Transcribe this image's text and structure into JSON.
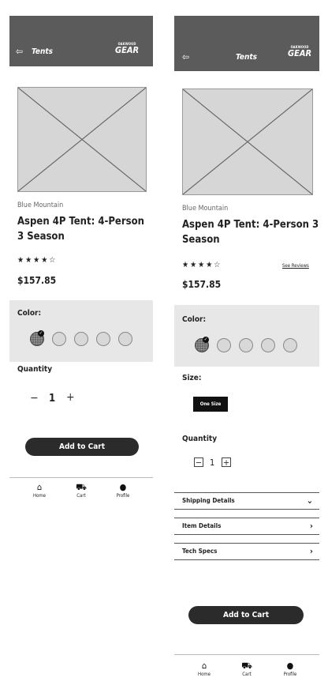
{
  "left": {
    "header": {
      "back_icon": "back-arrow",
      "title": "Tents"
    },
    "logo": {
      "small": "OAKWOOD",
      "big": "GEAR"
    },
    "product": {
      "brand": "Blue Mountain",
      "name": "Aspen 4P Tent: 4-Person 3 Season",
      "rating_stars": "★★★★☆",
      "price": "$157.85"
    },
    "color": {
      "label": "Color:",
      "selected_mark": "✓"
    },
    "quantity": {
      "label": "Quantity",
      "minus": "−",
      "value": "1",
      "plus": "+"
    },
    "add_to_cart": "Add to Cart",
    "nav": [
      {
        "icon": "home-icon",
        "label": "Home"
      },
      {
        "icon": "cart-icon",
        "label": "Cart"
      },
      {
        "icon": "profile-icon",
        "label": "Profile"
      }
    ]
  },
  "right": {
    "header": {
      "back_icon": "back-arrow",
      "title": "Tents"
    },
    "logo": {
      "small": "OAKWOOD",
      "big": "GEAR"
    },
    "product": {
      "brand": "Blue Mountain",
      "name": "Aspen 4P Tent: 4-Person 3 Season",
      "rating_stars": "★★★★☆",
      "see_reviews": "See Reviews",
      "price": "$157.85"
    },
    "color": {
      "label": "Color:",
      "selected_mark": "✓"
    },
    "size": {
      "label": "Size:",
      "option": "One Size"
    },
    "quantity": {
      "label": "Quantity",
      "minus": "−",
      "value": "1",
      "plus": "+"
    },
    "accordions": [
      {
        "label": "Shipping Details",
        "chevron": "⌄"
      },
      {
        "label": "Item Details",
        "chevron": "›"
      },
      {
        "label": "Tech Specs",
        "chevron": "›"
      }
    ],
    "add_to_cart": "Add to Cart",
    "nav": [
      {
        "icon": "home-icon",
        "label": "Home"
      },
      {
        "icon": "cart-icon",
        "label": "Cart"
      },
      {
        "icon": "profile-icon",
        "label": "Profile"
      }
    ]
  },
  "icons": {
    "back": "⇦",
    "home": "⌂",
    "cart": "🛒",
    "profile": "👤"
  },
  "colors": {
    "header_bg": "#5b5b5b",
    "panel_bg": "#e7e7e7",
    "button_bg": "#2b2b2b"
  }
}
